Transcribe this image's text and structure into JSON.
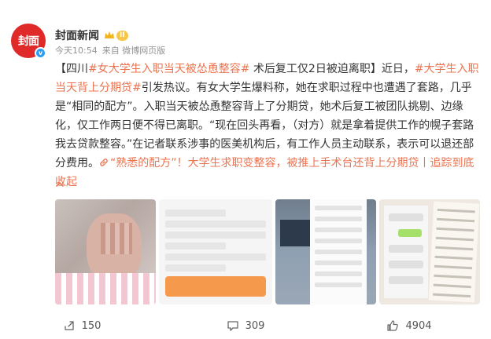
{
  "author": {
    "avatar_text": "封面",
    "name": "封面新闻",
    "level": "II",
    "time": "今天10:54",
    "source": "来自 微博网页版"
  },
  "post": {
    "prefix": "【四川",
    "tag1": "#女大学生入职当天被怂恿整容#",
    "seg1": " 术后复工仅2日被迫离职】近日，",
    "tag2": "#大学生入职当天背上分期贷#",
    "seg2": "引发热议。有女大学生爆料称，她在求职过程中也遭遇了套路，几乎是“相同的配方”。入职当天被怂恿整容背上了分期贷，她术后复工被团队挑剔、边缘化，仅工作两日便不得已离职。“现在回头再看，（对方）就是拿着提供工作的幌子套路我去贷款整容。”在记者联系涉事的医美机构后，有工作人员主动联系，表示可以退还部分费用。",
    "link_text": "“熟悉的配方”！大学生求职变整容，被推上手术台还背上分期贷丨追踪到底",
    "collapse_label": " 收起"
  },
  "stats": {
    "reposts": "150",
    "comments": "309",
    "likes": "4904"
  },
  "colors": {
    "accent": "#eb7350",
    "brand": "#e02a2a"
  },
  "icons": [
    "crown-icon",
    "link-icon",
    "chevron-up-icon",
    "repost-icon",
    "comment-icon",
    "like-icon"
  ]
}
